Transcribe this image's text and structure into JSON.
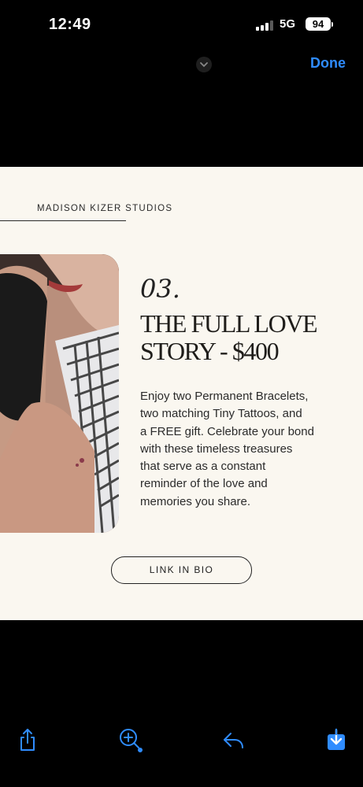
{
  "status_bar": {
    "time": "12:49",
    "network": "5G",
    "battery": "94"
  },
  "nav": {
    "done_label": "Done"
  },
  "post": {
    "studio_name": "MADISON KIZER STUDIOS",
    "number": "03.",
    "title_line1": "THE FULL LOVE",
    "title_line2": "STORY - $400",
    "body_lines": [
      "Enjoy two Permanent Bracelets,",
      "two matching Tiny Tattoos, and",
      "a FREE gift. Celebrate your bond",
      "with these timeless treasures",
      "that serve as a constant",
      "reminder of the love and",
      "memories you share."
    ],
    "link_label": "LINK IN BIO"
  },
  "colors": {
    "accent": "#2f8cff",
    "card_bg": "#faf7f0",
    "text": "#1f1d1a"
  },
  "toolbar": {
    "icons": [
      "share-icon",
      "zoom-in-icon",
      "reply-icon",
      "save-icon"
    ]
  }
}
